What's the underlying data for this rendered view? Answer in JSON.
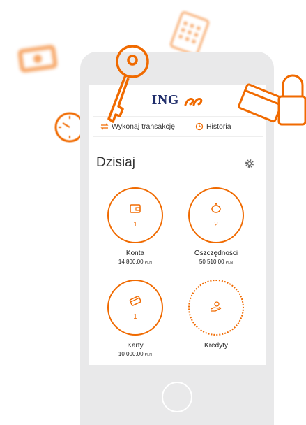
{
  "app": {
    "logo_text": "ING"
  },
  "actions": {
    "transaction_label": "Wykonaj transakcję",
    "history_label": "Historia"
  },
  "page": {
    "title": "Dzisiaj"
  },
  "tiles": [
    {
      "label": "Konta",
      "count": "1",
      "amount": "14 800,00",
      "currency": "PLN",
      "icon": "wallet-icon"
    },
    {
      "label": "Oszczędności",
      "count": "2",
      "amount": "50 510,00",
      "currency": "PLN",
      "icon": "piggy-bank-icon"
    },
    {
      "label": "Karty",
      "count": "1",
      "amount": "10 000,00",
      "currency": "PLN",
      "icon": "card-icon"
    },
    {
      "label": "Kredyty",
      "icon": "hand-coins-icon"
    }
  ],
  "decorations": [
    "key-icon",
    "calculator-icon",
    "clock-icon",
    "credit-card-icon",
    "padlock-icon",
    "cash-icon"
  ],
  "colors": {
    "accent": "#f06a00",
    "brand_navy": "#1f2d6b"
  }
}
